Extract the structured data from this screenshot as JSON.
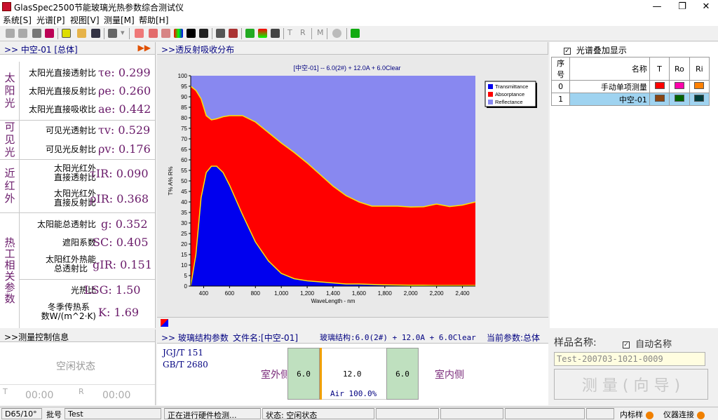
{
  "title": "GlasSpec2500节能玻璃光热参数综合测试仪",
  "window_buttons": [
    "—",
    "❐",
    "✕"
  ],
  "menu": [
    "系统[S]",
    "光谱[P]",
    "视图[V]",
    "测量[M]",
    "帮助[H]"
  ],
  "toolbar_text": [
    "T",
    "R",
    "M"
  ],
  "params_panel": {
    "header": ">>  中空-01   [总体]",
    "groups": [
      {
        "category": "太阳光",
        "rows": [
          {
            "label": "太阳光直接透射比",
            "symbol": "τe:",
            "value": "0.299"
          },
          {
            "label": "太阳光直接反射比",
            "symbol": "ρe:",
            "value": "0.260"
          },
          {
            "label": "太阳光直接吸收比",
            "symbol": "ae:",
            "value": "0.442"
          }
        ]
      },
      {
        "category": "可见光",
        "rows": [
          {
            "label": "可见光透射比",
            "symbol": "τv:",
            "value": "0.529"
          },
          {
            "label": "可见光反射比",
            "symbol": "ρv:",
            "value": "0.176"
          }
        ]
      },
      {
        "category": "近红外",
        "rows": [
          {
            "label": "太阳光红外\n直接透射比",
            "symbol": "τIR:",
            "value": "0.090"
          },
          {
            "label": "太阳光红外\n直接反射比",
            "symbol": "ρIR:",
            "value": "0.368"
          }
        ]
      },
      {
        "category": "热工相关参数",
        "rows": [
          {
            "label": "太阳能总透射比",
            "symbol": "g:",
            "value": "0.352"
          },
          {
            "label": "遮阳系数",
            "symbol": "SC:",
            "value": "0.405"
          },
          {
            "label": "太阳红外热能\n总透射比",
            "symbol": "gIR:",
            "value": "0.151"
          }
        ]
      },
      {
        "category": "",
        "rows": [
          {
            "label": "光热比",
            "symbol": "LSG:",
            "value": "1.50"
          },
          {
            "label": "冬季传热系\n数W/(m^2·K)",
            "symbol": "K:",
            "value": "1.69"
          }
        ]
      }
    ]
  },
  "measure_ctrl": {
    "header": ">>测量控制信息",
    "status": "空闲状态",
    "t_label": "T",
    "t_value": "00:00",
    "r_label": "R",
    "r_value": "00:00"
  },
  "chart_panel": {
    "header": ">>透反射吸收分布"
  },
  "chart_data": {
    "type": "area",
    "title": "[中空-01] -- 6.0(2#) + 12.0A + 6.0Clear",
    "xlabel": "WaveLength - nm",
    "ylabel": "T% A% R%",
    "xlim": [
      300,
      2500
    ],
    "ylim": [
      0,
      100
    ],
    "xticks": [
      "400",
      "600",
      "800",
      "1,000",
      "1,200",
      "1,400",
      "1,600",
      "1,800",
      "2,000",
      "2,200",
      "2,400"
    ],
    "yticks": [
      "0",
      "5",
      "10",
      "15",
      "20",
      "25",
      "30",
      "35",
      "40",
      "45",
      "50",
      "55",
      "60",
      "65",
      "70",
      "75",
      "80",
      "85",
      "90",
      "95",
      "100"
    ],
    "legend": [
      "Transmittance",
      "Absorptance",
      "Reflectance"
    ],
    "legend_position": "top-right",
    "colors": {
      "transmittance": "#0000ee",
      "absorptance": "#ff0000",
      "reflectance": "#8888f0"
    },
    "x": [
      300,
      340,
      380,
      420,
      460,
      500,
      550,
      600,
      700,
      800,
      900,
      1000,
      1100,
      1200,
      1300,
      1400,
      1500,
      1600,
      1700,
      1800,
      1900,
      2000,
      2100,
      2200,
      2300,
      2400,
      2500
    ],
    "series": [
      {
        "name": "Transmittance",
        "values": [
          0,
          15,
          42,
          54,
          57,
          57,
          54,
          48,
          34,
          21,
          12,
          6,
          3.5,
          2.5,
          2,
          1.5,
          1,
          1,
          0.8,
          0.6,
          0.5,
          0.4,
          0.4,
          0.3,
          0.3,
          0.3,
          0.3
        ]
      },
      {
        "name": "Absorptance",
        "values": [
          95,
          78,
          47,
          27,
          22,
          22.5,
          26.5,
          33,
          47,
          57,
          61,
          62,
          60,
          56,
          51,
          46,
          42,
          39,
          37.2,
          37.4,
          37.5,
          37.2,
          37.3,
          38.7,
          37.5,
          38.2,
          39.7
        ]
      },
      {
        "name": "Reflectance",
        "values": [
          5,
          7,
          11,
          19,
          21,
          20.5,
          19.5,
          19,
          19,
          22,
          27,
          32,
          36.5,
          41.5,
          47,
          52.5,
          57,
          60,
          62,
          62,
          62,
          62.4,
          62.3,
          61,
          62.2,
          61.5,
          60
        ]
      }
    ]
  },
  "right_panel": {
    "overlay_label": "光谱叠加显示",
    "overlay_checked": "✓",
    "columns": [
      "序号",
      "名称",
      "T",
      "Ro",
      "Ri"
    ],
    "rows": [
      {
        "index": "0",
        "name": "手动单项测量",
        "colors": [
          "#ff0000",
          "#ff00aa",
          "#ff8000"
        ]
      },
      {
        "index": "1",
        "name": "中空-01",
        "colors": [
          "#8b4513",
          "#006400",
          "#003c3c"
        ]
      }
    ]
  },
  "glass_panel": {
    "header_items": [
      ">>  玻璃结构参数",
      "文件名:[中空-01]",
      "玻璃结构:6.0(2#) + 12.0A + 6.0Clear",
      "当前参数:总体"
    ],
    "standards": [
      "JGJ/T 151",
      "GB/T 2680"
    ],
    "outdoor_label": "室外侧",
    "indoor_label": "室内侧",
    "layer1": "6.0",
    "gap": "12.0",
    "gas": "Air 100.0%",
    "layer2": "6.0"
  },
  "sample_panel": {
    "label": "样品名称:",
    "auto_label": "自动名称",
    "auto_checked": "✓",
    "sample_name": "Test-200703-1021-0009",
    "measure_button": "测 量 ( 向 导 )"
  },
  "statusbar": {
    "illuminant": "D65/10°",
    "batch_label": "批号",
    "batch_value": "Test",
    "hardware": "正在进行硬件检测...",
    "state": "状态: 空闲状态",
    "internal_label": "内标样",
    "device_label": "仪器连接"
  }
}
